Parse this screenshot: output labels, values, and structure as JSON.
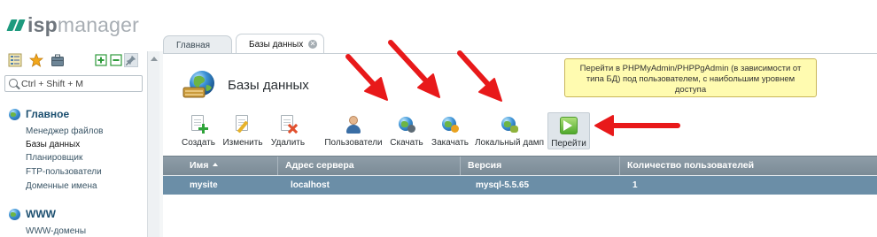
{
  "app": {
    "logo_bold": "isp",
    "logo_rest": "manager"
  },
  "colors": {
    "logo_accent": "#1e9a7e",
    "grid_header": "#8595a0",
    "grid_selected_row": "#6b8ea7",
    "tooltip_bg": "#fffbb0",
    "annotation_arrow": "#e8191a"
  },
  "sidebar": {
    "toolbar_icons": [
      "tree-view-icon",
      "star-icon",
      "briefcase-icon",
      "expand-all-icon",
      "collapse-all-icon",
      "pin-icon"
    ],
    "search_placeholder": "Ctrl + Shift + M",
    "groups": [
      {
        "title": "Главное",
        "icon": "globe-icon",
        "items": [
          "Менеджер файлов",
          "Базы данных",
          "Планировщик",
          "FTP-пользователи",
          "Доменные имена"
        ],
        "active_index": 1
      },
      {
        "title": "WWW",
        "icon": "globe-icon",
        "items": [
          "WWW-домены"
        ]
      }
    ]
  },
  "tabs": [
    {
      "label": "Главная",
      "active": false
    },
    {
      "label": "Базы данных",
      "active": true,
      "closable": true
    }
  ],
  "page": {
    "title": "Базы данных",
    "icon": "database-globe-icon"
  },
  "toolbar": {
    "create": "Создать",
    "edit": "Изменить",
    "delete": "Удалить",
    "users": "Пользователи",
    "download": "Скачать",
    "upload": "Закачать",
    "local_dump": "Локальный дамп",
    "go": "Перейти"
  },
  "tooltip": {
    "text": "Перейти в PHPMyAdmin/PHPPgAdmin (в зависимости от типа БД) под пользователем, с наибольшим уровнем доступа"
  },
  "grid": {
    "columns": [
      "Имя",
      "Адрес сервера",
      "Версия",
      "Количество пользователей"
    ],
    "sorted_column": 0,
    "sort_direction": "asc",
    "rows": [
      [
        "mysite",
        "localhost",
        "mysql-5.5.65",
        "1"
      ]
    ],
    "selected_row": 0
  }
}
